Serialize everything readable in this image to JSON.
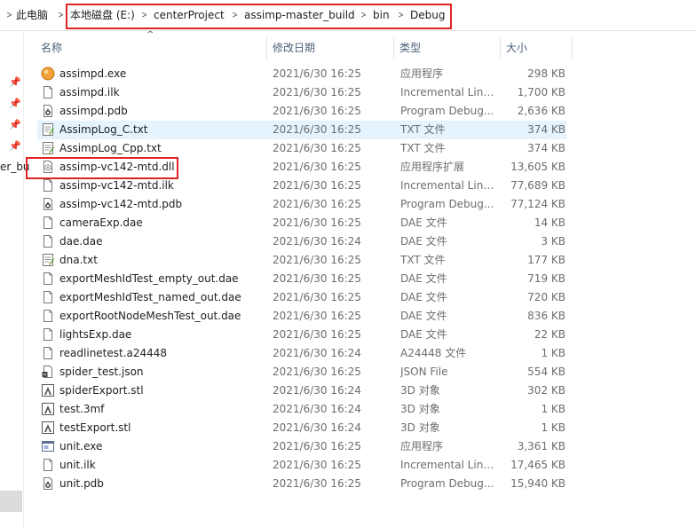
{
  "breadcrumb": {
    "root": "此电脑",
    "items": [
      "本地磁盘 (E:)",
      "centerProject",
      "assimp-master_build",
      "bin",
      "Debug"
    ]
  },
  "nav": {
    "cut_label": "er_bu"
  },
  "columns": {
    "name": "名称",
    "date": "修改日期",
    "type": "类型",
    "size": "大小"
  },
  "highlight_color": "#e02424",
  "selection_color": "#e5f3ff",
  "files": [
    {
      "name": "assimpd.exe",
      "date": "2021/6/30 16:25",
      "type": "应用程序",
      "size": "298 KB",
      "icon": "exe-icon"
    },
    {
      "name": "assimpd.ilk",
      "date": "2021/6/30 16:25",
      "type": "Incremental Link...",
      "size": "1,700 KB",
      "icon": "file-icon"
    },
    {
      "name": "assimpd.pdb",
      "date": "2021/6/30 16:25",
      "type": "Program Debug...",
      "size": "2,636 KB",
      "icon": "pdb-icon"
    },
    {
      "name": "AssimpLog_C.txt",
      "date": "2021/6/30 16:25",
      "type": "TXT 文件",
      "size": "374 KB",
      "icon": "txt-icon"
    },
    {
      "name": "AssimpLog_Cpp.txt",
      "date": "2021/6/30 16:25",
      "type": "TXT 文件",
      "size": "374 KB",
      "icon": "txt-icon"
    },
    {
      "name": "assimp-vc142-mtd.dll",
      "date": "2021/6/30 16:25",
      "type": "应用程序扩展",
      "size": "13,605 KB",
      "icon": "dll-icon"
    },
    {
      "name": "assimp-vc142-mtd.ilk",
      "date": "2021/6/30 16:25",
      "type": "Incremental Link...",
      "size": "77,689 KB",
      "icon": "file-icon"
    },
    {
      "name": "assimp-vc142-mtd.pdb",
      "date": "2021/6/30 16:25",
      "type": "Program Debug...",
      "size": "77,124 KB",
      "icon": "pdb-icon"
    },
    {
      "name": "cameraExp.dae",
      "date": "2021/6/30 16:25",
      "type": "DAE 文件",
      "size": "14 KB",
      "icon": "file-icon"
    },
    {
      "name": "dae.dae",
      "date": "2021/6/30 16:24",
      "type": "DAE 文件",
      "size": "3 KB",
      "icon": "file-icon"
    },
    {
      "name": "dna.txt",
      "date": "2021/6/30 16:25",
      "type": "TXT 文件",
      "size": "177 KB",
      "icon": "txt-icon"
    },
    {
      "name": "exportMeshIdTest_empty_out.dae",
      "date": "2021/6/30 16:25",
      "type": "DAE 文件",
      "size": "719 KB",
      "icon": "file-icon"
    },
    {
      "name": "exportMeshIdTest_named_out.dae",
      "date": "2021/6/30 16:25",
      "type": "DAE 文件",
      "size": "720 KB",
      "icon": "file-icon"
    },
    {
      "name": "exportRootNodeMeshTest_out.dae",
      "date": "2021/6/30 16:25",
      "type": "DAE 文件",
      "size": "836 KB",
      "icon": "file-icon"
    },
    {
      "name": "lightsExp.dae",
      "date": "2021/6/30 16:25",
      "type": "DAE 文件",
      "size": "22 KB",
      "icon": "file-icon"
    },
    {
      "name": "readlinetest.a24448",
      "date": "2021/6/30 16:24",
      "type": "A24448 文件",
      "size": "1 KB",
      "icon": "file-icon"
    },
    {
      "name": "spider_test.json",
      "date": "2021/6/30 16:25",
      "type": "JSON File",
      "size": "554 KB",
      "icon": "json-icon"
    },
    {
      "name": "spiderExport.stl",
      "date": "2021/6/30 16:24",
      "type": "3D 对象",
      "size": "302 KB",
      "icon": "3d-object-icon"
    },
    {
      "name": "test.3mf",
      "date": "2021/6/30 16:24",
      "type": "3D 对象",
      "size": "1 KB",
      "icon": "3d-object-icon"
    },
    {
      "name": "testExport.stl",
      "date": "2021/6/30 16:24",
      "type": "3D 对象",
      "size": "1 KB",
      "icon": "3d-object-icon"
    },
    {
      "name": "unit.exe",
      "date": "2021/6/30 16:25",
      "type": "应用程序",
      "size": "3,361 KB",
      "icon": "app-window-icon"
    },
    {
      "name": "unit.ilk",
      "date": "2021/6/30 16:25",
      "type": "Incremental Link...",
      "size": "17,465 KB",
      "icon": "file-icon"
    },
    {
      "name": "unit.pdb",
      "date": "2021/6/30 16:25",
      "type": "Program Debug...",
      "size": "15,940 KB",
      "icon": "pdb-icon"
    }
  ]
}
